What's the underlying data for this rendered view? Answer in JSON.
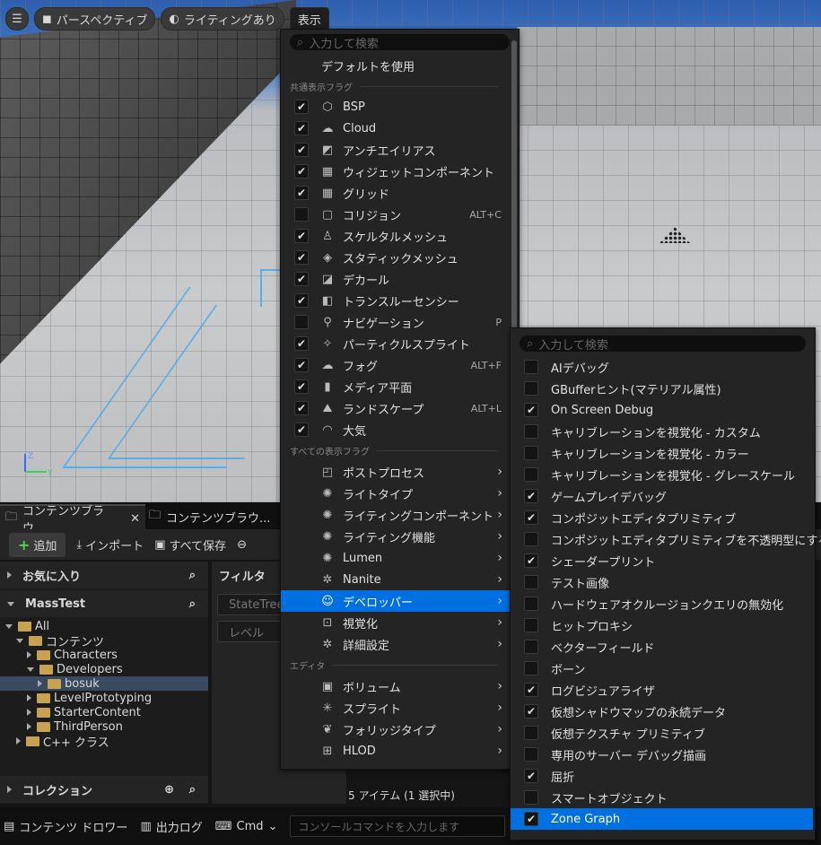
{
  "toolbar": {
    "perspective": "パースペクティブ",
    "lighting": "ライティングあり",
    "show": "表示"
  },
  "show_menu": {
    "search_placeholder": "入力して検索",
    "use_default": "デフォルトを使用",
    "common_header": "共通表示フラグ",
    "common_items": [
      {
        "label": "BSP",
        "checked": true,
        "icon": "bsp-icon",
        "shortcut": ""
      },
      {
        "label": "Cloud",
        "checked": true,
        "icon": "cloud-icon",
        "shortcut": ""
      },
      {
        "label": "アンチエイリアス",
        "checked": true,
        "icon": "antialias-icon",
        "shortcut": ""
      },
      {
        "label": "ウィジェットコンポーネント",
        "checked": true,
        "icon": "widget-icon",
        "shortcut": ""
      },
      {
        "label": "グリッド",
        "checked": true,
        "icon": "grid-icon",
        "shortcut": ""
      },
      {
        "label": "コリジョン",
        "checked": false,
        "icon": "collision-icon",
        "shortcut": "ALT+C"
      },
      {
        "label": "スケルタルメッシュ",
        "checked": true,
        "icon": "skeletal-mesh-icon",
        "shortcut": ""
      },
      {
        "label": "スタティックメッシュ",
        "checked": true,
        "icon": "static-mesh-icon",
        "shortcut": ""
      },
      {
        "label": "デカール",
        "checked": true,
        "icon": "decal-icon",
        "shortcut": ""
      },
      {
        "label": "トランスルーセンシー",
        "checked": true,
        "icon": "translucency-icon",
        "shortcut": ""
      },
      {
        "label": "ナビゲーション",
        "checked": false,
        "icon": "navigation-icon",
        "shortcut": "P"
      },
      {
        "label": "パーティクルスプライト",
        "checked": true,
        "icon": "particle-icon",
        "shortcut": ""
      },
      {
        "label": "フォグ",
        "checked": true,
        "icon": "fog-icon",
        "shortcut": "ALT+F"
      },
      {
        "label": "メディア平面",
        "checked": true,
        "icon": "media-plane-icon",
        "shortcut": ""
      },
      {
        "label": "ランドスケープ",
        "checked": true,
        "icon": "landscape-icon",
        "shortcut": "ALT+L"
      },
      {
        "label": "大気",
        "checked": true,
        "icon": "atmosphere-icon",
        "shortcut": ""
      }
    ],
    "all_header": "すべての表示フラグ",
    "all_items": [
      {
        "label": "ポストプロセス",
        "icon": "post-process-icon"
      },
      {
        "label": "ライトタイプ",
        "icon": "light-type-icon"
      },
      {
        "label": "ライティングコンポーネント",
        "icon": "lighting-component-icon"
      },
      {
        "label": "ライティング機能",
        "icon": "lighting-feature-icon"
      },
      {
        "label": "Lumen",
        "icon": "lumen-icon"
      },
      {
        "label": "Nanite",
        "icon": "nanite-icon"
      },
      {
        "label": "デベロッパー",
        "icon": "developer-icon"
      },
      {
        "label": "視覚化",
        "icon": "visualize-icon"
      },
      {
        "label": "詳細設定",
        "icon": "advanced-icon"
      }
    ],
    "editor_header": "エディタ",
    "editor_items": [
      {
        "label": "ボリューム",
        "icon": "volume-icon"
      },
      {
        "label": "スプライト",
        "icon": "sprite-icon"
      },
      {
        "label": "フォリッジタイプ",
        "icon": "foliage-icon"
      },
      {
        "label": "HLOD",
        "icon": "hlod-icon"
      }
    ]
  },
  "developer_menu": {
    "search_placeholder": "入力して検索",
    "items": [
      {
        "label": "AIデバッグ",
        "checked": false
      },
      {
        "label": "GBufferヒント(マテリアル属性)",
        "checked": false
      },
      {
        "label": "On Screen Debug",
        "checked": true
      },
      {
        "label": "キャリブレーションを視覚化 - カスタム",
        "checked": false
      },
      {
        "label": "キャリブレーションを視覚化 - カラー",
        "checked": false
      },
      {
        "label": "キャリブレーションを視覚化 - グレースケール",
        "checked": false
      },
      {
        "label": "ゲームプレイデバッグ",
        "checked": true
      },
      {
        "label": "コンポジットエディタプリミティブ",
        "checked": true
      },
      {
        "label": "コンポジットエディタプリミティブを不透明型にする",
        "checked": false
      },
      {
        "label": "シェーダープリント",
        "checked": true
      },
      {
        "label": "テスト画像",
        "checked": false
      },
      {
        "label": "ハードウェアオクルージョンクエリの無効化",
        "checked": false
      },
      {
        "label": "ヒットプロキシ",
        "checked": false
      },
      {
        "label": "ベクターフィールド",
        "checked": false
      },
      {
        "label": "ボーン",
        "checked": false
      },
      {
        "label": "ログビジュアライザ",
        "checked": true
      },
      {
        "label": "仮想シャドウマップの永続データ",
        "checked": true
      },
      {
        "label": "仮想テクスチャ プリミティブ",
        "checked": false
      },
      {
        "label": "専用のサーバー デバッグ描画",
        "checked": false
      },
      {
        "label": "屈折",
        "checked": true
      },
      {
        "label": "スマートオブジェクト",
        "checked": false
      },
      {
        "label": "Zone Graph",
        "checked": true
      }
    ]
  },
  "content_browser": {
    "tab1": "コンテンツブラウ...",
    "tab2": "コンテンツブラウ...",
    "add": "追加",
    "import": "インポート",
    "save_all": "すべて保存",
    "favorites": "お気に入り",
    "project": "MassTest",
    "tree": [
      {
        "label": "All",
        "indent": 0,
        "expanded": true,
        "selected": false
      },
      {
        "label": "コンテンツ",
        "indent": 1,
        "expanded": true,
        "selected": false
      },
      {
        "label": "Characters",
        "indent": 2,
        "expanded": false,
        "selected": false
      },
      {
        "label": "Developers",
        "indent": 2,
        "expanded": true,
        "selected": false
      },
      {
        "label": "bosuk",
        "indent": 3,
        "expanded": false,
        "selected": true
      },
      {
        "label": "LevelPrototyping",
        "indent": 2,
        "expanded": false,
        "selected": false
      },
      {
        "label": "StarterContent",
        "indent": 2,
        "expanded": false,
        "selected": false
      },
      {
        "label": "ThirdPerson",
        "indent": 2,
        "expanded": false,
        "selected": false
      },
      {
        "label": "C++ クラス",
        "indent": 1,
        "expanded": false,
        "selected": false
      }
    ],
    "filter_title": "フィルタ",
    "filter_chips": [
      "StateTree",
      "レベル"
    ],
    "collections": "コレクション",
    "item_count": "5 アイテム (1 選択中)"
  },
  "statusbar": {
    "content_drawer": "コンテンツ ドロワー",
    "output_log": "出力ログ",
    "cmd": "Cmd",
    "console_placeholder": "コンソールコマンドを入力します"
  }
}
